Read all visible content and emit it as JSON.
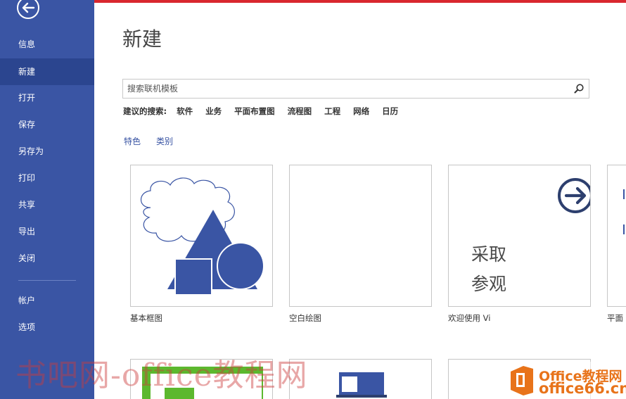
{
  "sidebar": {
    "items": [
      {
        "label": "信息"
      },
      {
        "label": "新建"
      },
      {
        "label": "打开"
      },
      {
        "label": "保存"
      },
      {
        "label": "另存为"
      },
      {
        "label": "打印"
      },
      {
        "label": "共享"
      },
      {
        "label": "导出"
      },
      {
        "label": "关闭"
      },
      {
        "label": "帐户"
      },
      {
        "label": "选项"
      }
    ],
    "active": "新建"
  },
  "main": {
    "title": "新建",
    "search": {
      "placeholder": "搜索联机模板"
    },
    "suggested": {
      "label": "建议的搜索:",
      "links": [
        "软件",
        "业务",
        "平面布置图",
        "流程图",
        "工程",
        "网络",
        "日历"
      ]
    },
    "tabs": [
      "特色",
      "类别"
    ],
    "templates": [
      {
        "label": "基本框图"
      },
      {
        "label": "空白绘图"
      },
      {
        "label": "欢迎使用 Vi",
        "tour_line1": "采取",
        "tour_line2": "参观"
      },
      {
        "label": "平面"
      }
    ]
  },
  "watermark": {
    "left_text": "书吧网-office教程网",
    "brand": "Office教程网",
    "site": "office66.cn"
  },
  "colors": {
    "sidebar": "#3a55a4",
    "sidebar_active": "#2b458f",
    "accent_red": "#d9272e",
    "shape_blue": "#3a55a4"
  }
}
